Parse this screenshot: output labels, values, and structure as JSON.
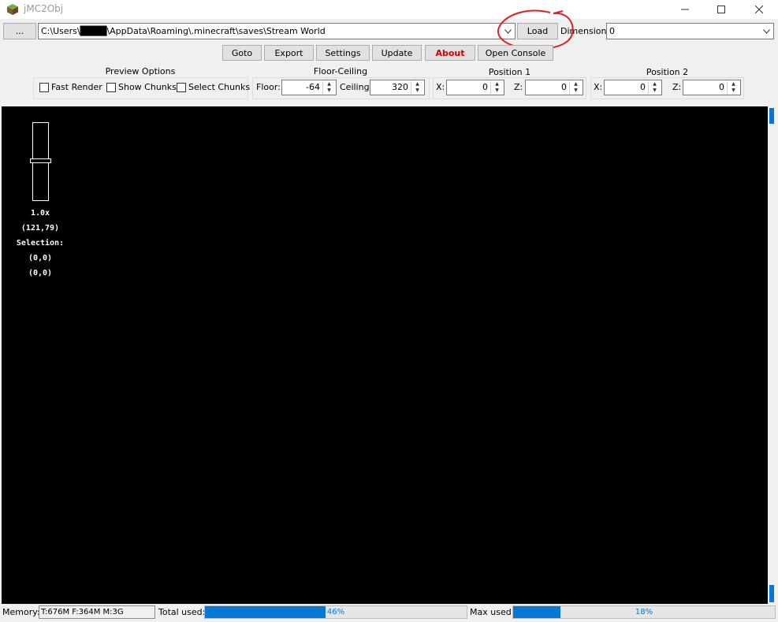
{
  "window": {
    "title": "jMC2Obj"
  },
  "toolbar": {
    "browse_label": "...",
    "path_value": "C:\\Users\\████\\AppData\\Roaming\\.minecraft\\saves\\Stream World",
    "load_label": "Load",
    "dimension_label": "Dimension:",
    "dimension_value": "0"
  },
  "actions": [
    "Goto",
    "Export",
    "Settings",
    "Update",
    "About",
    "Open Console"
  ],
  "preview_options": {
    "title": "Preview Options",
    "fast_render": "Fast Render",
    "show_chunks": "Show Chunks",
    "select_chunks": "Select Chunks"
  },
  "floor_ceiling": {
    "title": "Floor-Ceiling",
    "floor_label": "Floor:",
    "floor_value": "-64",
    "ceiling_label": "Ceiling:",
    "ceiling_value": "320"
  },
  "position1": {
    "title": "Position 1",
    "x_label": "X:",
    "x_value": "0",
    "z_label": "Z:",
    "z_value": "0"
  },
  "position2": {
    "title": "Position 2",
    "x_label": "X:",
    "x_value": "0",
    "z_label": "Z:",
    "z_value": "0"
  },
  "map_overlay": {
    "zoom": "1.0x",
    "coords": "(121,79)",
    "selection_label": "Selection:",
    "selection_start": "(0,0)",
    "selection_end": "(0,0)"
  },
  "status": {
    "memory_label": "Memory:",
    "memory_value": "T:676M F:364M M:3G",
    "total_label": "Total used:",
    "total_percent": "46%",
    "total_fraction": 0.46,
    "max_label": "Max used:",
    "max_percent": "18%",
    "max_fraction": 0.18
  },
  "colors": {
    "about_text": "#d40000",
    "progress": "#0678d6",
    "annotation": "#e31e24"
  }
}
